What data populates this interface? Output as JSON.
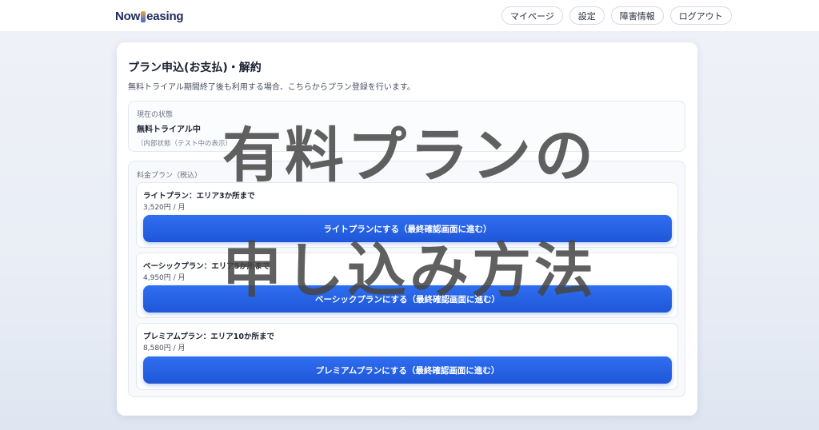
{
  "header": {
    "logo_text_left": "Now",
    "logo_text_right": "easing",
    "nav": [
      {
        "label": "マイページ"
      },
      {
        "label": "設定"
      },
      {
        "label": "障害情報"
      },
      {
        "label": "ログアウト"
      }
    ]
  },
  "panel": {
    "title": "プラン申込(お支払)・解約",
    "description": "無料トライアル期間終了後も利用する場合、こちらからプラン登録を行います。",
    "status": {
      "label": "現在の状態",
      "value": "無料トライアル中",
      "note": "（内部状態（テスト中の表示）"
    },
    "plans_label": "料金プラン（税込）",
    "plans": [
      {
        "name": "ライトプラン：エリア3か所まで",
        "price": "3,520円 / 月",
        "button": "ライトプランにする（最終確認画面に進む）"
      },
      {
        "name": "ベーシックプラン：エリア5か所まで",
        "price": "4,950円 / 月",
        "button": "ベーシックプランにする（最終確認画面に進む）"
      },
      {
        "name": "プレミアムプラン：エリア10か所まで",
        "price": "8,580円 / 月",
        "button": "プレミアムプランにする（最終確認画面に進む）"
      }
    ]
  },
  "overlay": {
    "line1": "有料プランの",
    "line2": "申し込み方法"
  },
  "colors": {
    "primary_button": "#2563eb",
    "overlay_text": "#464646"
  }
}
